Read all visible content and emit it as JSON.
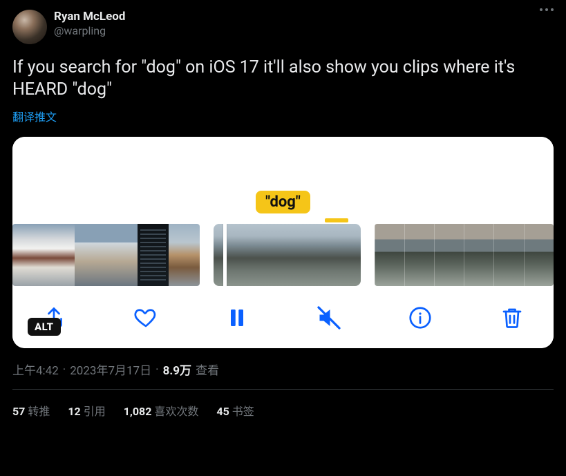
{
  "author": {
    "display_name": "Ryan McLeod",
    "handle": "@warpling"
  },
  "tweet_text": "If you search for \"dog\" on iOS 17 it'll also show you clips where it's HEARD \"dog\"",
  "translate_label": "翻译推文",
  "media": {
    "tooltip_label": "\"dog\"",
    "alt_badge": "ALT"
  },
  "meta": {
    "time": "上午4:42",
    "separator": "·",
    "date": "2023年7月17日",
    "views_number": "8.9万",
    "views_label": "查看"
  },
  "stats": {
    "retweets_count": "57",
    "retweets_label": "转推",
    "quotes_count": "12",
    "quotes_label": "引用",
    "likes_count": "1,082",
    "likes_label": "喜欢次数",
    "bookmarks_count": "45",
    "bookmarks_label": "书签"
  }
}
